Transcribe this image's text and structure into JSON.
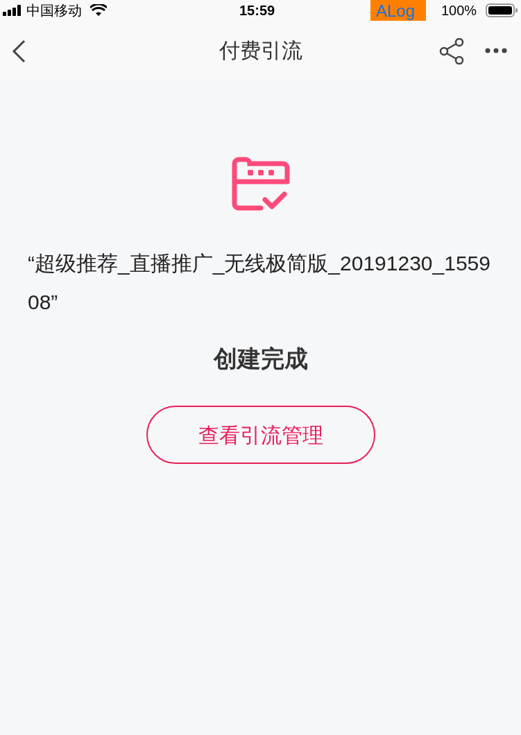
{
  "status_bar": {
    "carrier": "中国移动",
    "time": "15:59",
    "overlay_badge": "ALog",
    "battery_text": "100%"
  },
  "nav_bar": {
    "title": "付费引流"
  },
  "result": {
    "name": "“超级推荐_直播推广_无线极简版_20191230_155908”",
    "message": "创建完成",
    "button": "查看引流管理"
  }
}
